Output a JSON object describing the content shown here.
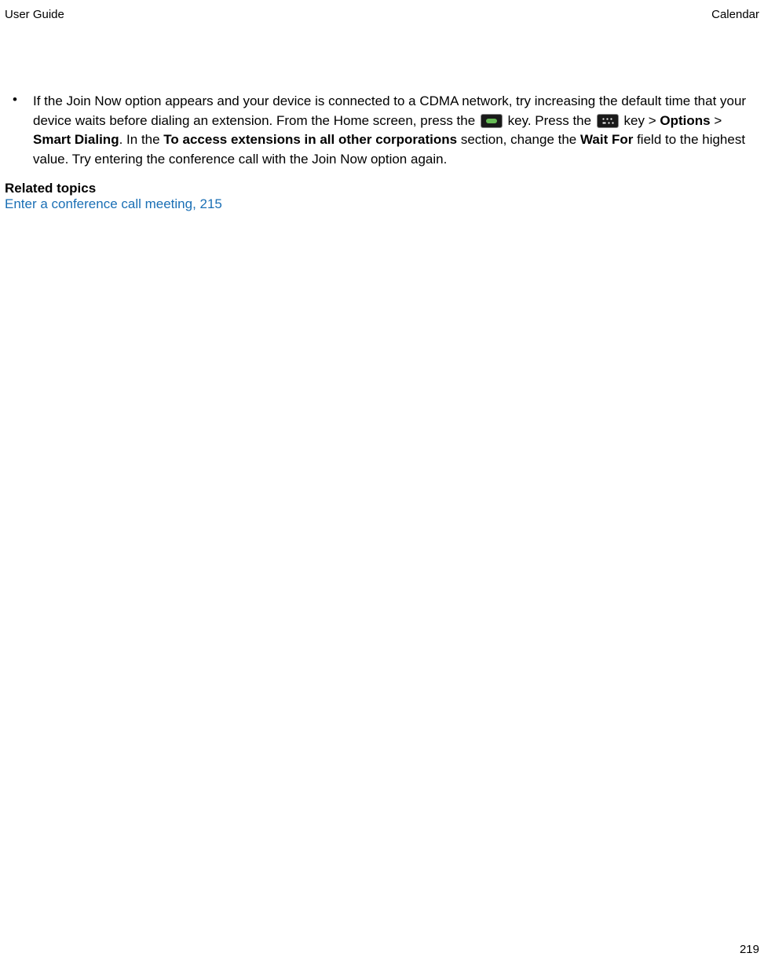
{
  "header": {
    "left": "User Guide",
    "right": "Calendar"
  },
  "bullet": {
    "marker": "•",
    "text1": "If the Join Now option appears and your device is connected to a CDMA network, try increasing the default time that your device waits before dialing an extension. From the Home screen, press the ",
    "text2": " key. Press the ",
    "text3": " key > ",
    "options": "Options",
    "text4": " > ",
    "smart_dialing": "Smart Dialing",
    "text5": ". In the ",
    "to_access": "To access extensions in all other corporations",
    "text6": " section, change the ",
    "wait_for": "Wait For",
    "text7": " field to the highest value. Try entering the conference call with the Join Now option again."
  },
  "related": {
    "heading": "Related topics",
    "link": "Enter a conference call meeting, 215"
  },
  "page_number": "219"
}
